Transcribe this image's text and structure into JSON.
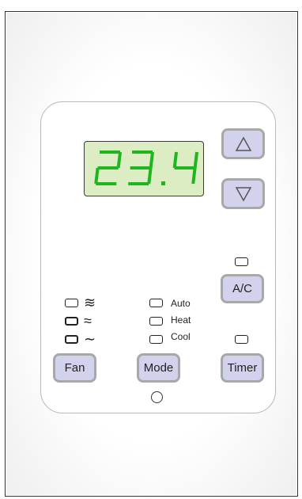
{
  "display": {
    "temperature": "23.4",
    "digit_color": "#1fb51f",
    "background_color": "#dcedc4"
  },
  "buttons": {
    "up_icon": "triangle-up-icon",
    "down_icon": "triangle-down-icon",
    "ac_label": "A/C",
    "fan_label": "Fan",
    "mode_label": "Mode",
    "timer_label": "Timer",
    "button_color": "#d3d2ec"
  },
  "fan_speeds": [
    {
      "icon": "≋",
      "name": "fan-high-icon"
    },
    {
      "icon": "≈",
      "name": "fan-medium-icon"
    },
    {
      "icon": "∼",
      "name": "fan-low-icon"
    }
  ],
  "modes": {
    "auto": "Auto",
    "heat": "Heat",
    "cool": "Cool"
  }
}
